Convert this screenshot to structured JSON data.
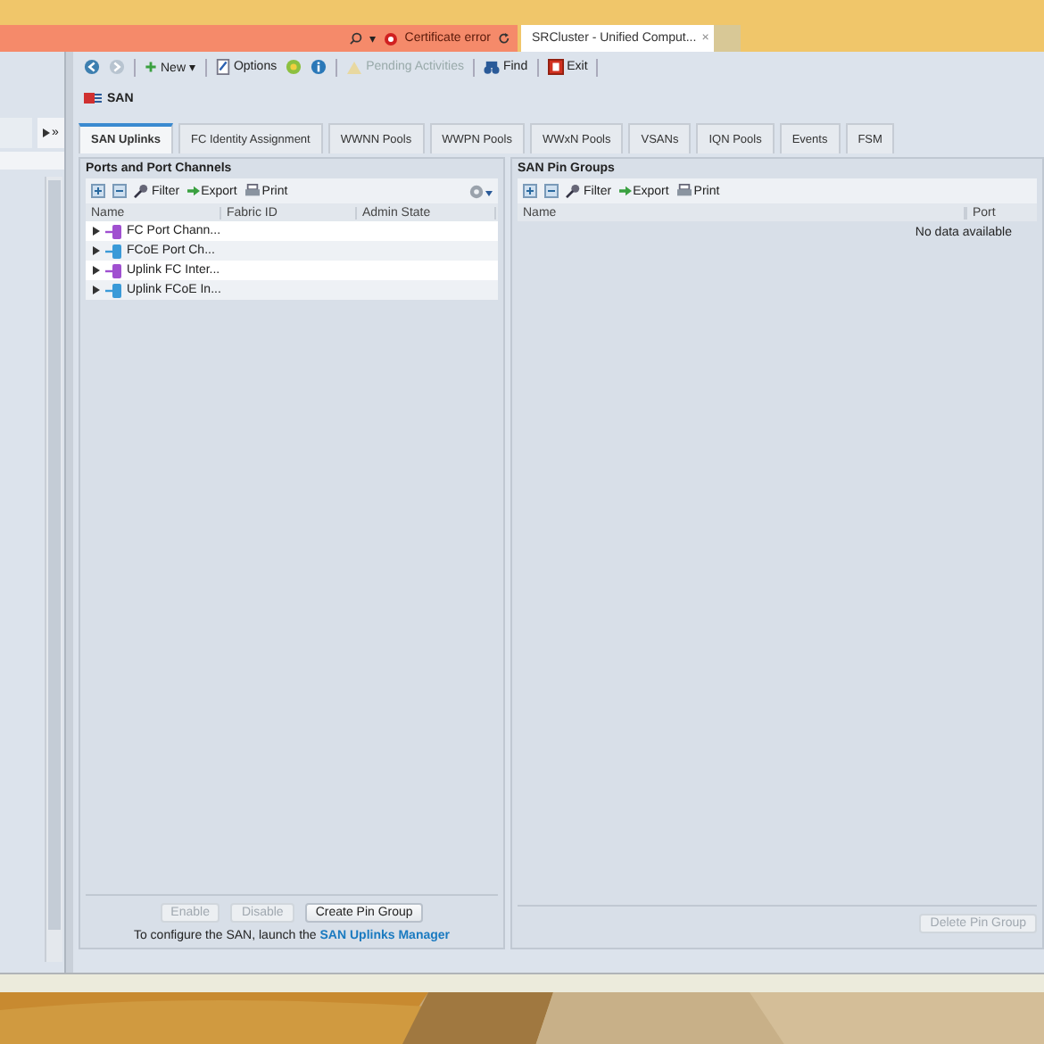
{
  "browser": {
    "search_caret": "▾",
    "certificate": "Certificate error",
    "tab": {
      "title": "SRCluster - Unified Comput...",
      "close": "×"
    }
  },
  "toolbar": [
    {
      "kind": "icon",
      "disabled": false
    },
    {
      "kind": "icon",
      "disabled": true
    },
    {
      "kind": "button",
      "label": "New",
      "caret": "▾",
      "disabled": false
    },
    {
      "kind": "button",
      "label": "Options",
      "disabled": false
    },
    {
      "kind": "icon",
      "disabled": false
    },
    {
      "kind": "icon",
      "disabled": false
    },
    {
      "kind": "button",
      "label": "Pending Activities",
      "disabled": true
    },
    {
      "kind": "button",
      "label": "Find",
      "disabled": false
    },
    {
      "kind": "button",
      "label": "Exit",
      "disabled": false
    }
  ],
  "breadcrumb": "SAN",
  "sidebar": {
    "more": "»"
  },
  "tabs": [
    {
      "label": "SAN Uplinks",
      "selected": true
    },
    {
      "label": "FC Identity Assignment",
      "selected": false
    },
    {
      "label": "WWNN Pools",
      "selected": false
    },
    {
      "label": "WWPN Pools",
      "selected": false
    },
    {
      "label": "WWxN Pools",
      "selected": false
    },
    {
      "label": "VSANs",
      "selected": false
    },
    {
      "label": "IQN Pools",
      "selected": false
    },
    {
      "label": "Events",
      "selected": false
    },
    {
      "label": "FSM",
      "selected": false
    }
  ],
  "ports_panel": {
    "title": "Ports and Port Channels",
    "actions": [
      "Filter",
      "Export",
      "Print"
    ],
    "columns": [
      "Name",
      "Fabric ID",
      "Admin State"
    ],
    "rows": [
      {
        "name": "FC Port Chann...",
        "color": "#a050d0"
      },
      {
        "name": "FCoE Port Ch...",
        "color": "#3a9ad8"
      },
      {
        "name": "Uplink FC Inter...",
        "color": "#a050d0"
      },
      {
        "name": "Uplink FCoE In...",
        "color": "#3a9ad8"
      }
    ],
    "buttons": [
      {
        "label": "Enable",
        "disabled": true
      },
      {
        "label": "Disable",
        "disabled": true
      },
      {
        "label": "Create Pin Group",
        "disabled": false
      }
    ],
    "note": "To configure the SAN, launch the",
    "link": "SAN Uplinks Manager"
  },
  "pin_groups_panel": {
    "title": "SAN Pin Groups",
    "actions": [
      "Filter",
      "Export",
      "Print"
    ],
    "columns": [
      "Name",
      "Port"
    ],
    "empty": "No data available",
    "buttons": [
      {
        "label": "Delete Pin Group",
        "disabled": true
      }
    ]
  }
}
